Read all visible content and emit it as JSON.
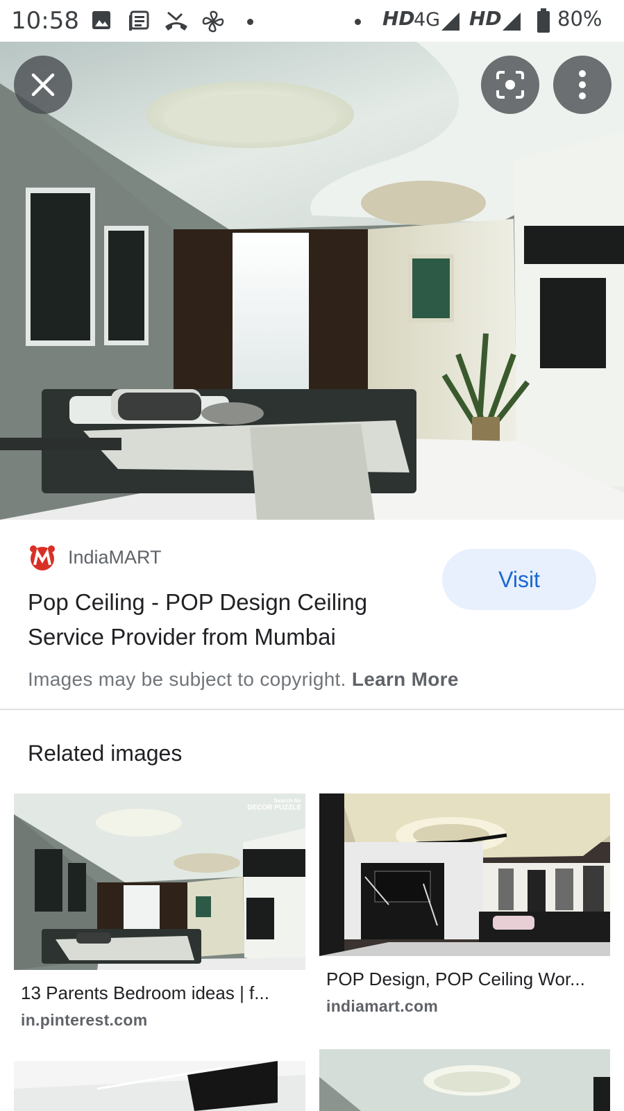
{
  "status_bar": {
    "time": "10:58",
    "network_label_1": "HD",
    "network_type": "4G",
    "network_label_2": "HD",
    "battery": "80%",
    "icons": [
      "image-icon",
      "news-icon",
      "missed-call-icon",
      "fan-icon",
      "notification-dot-icon"
    ]
  },
  "hero": {
    "close_icon": "close-icon",
    "lens_icon": "lens-icon",
    "menu_icon": "more-vert-icon"
  },
  "result": {
    "source_name": "IndiaMART",
    "title": "Pop Ceiling - POP Design Ceiling Service Provider from Mumbai",
    "visit_label": "Visit",
    "copyright_text": "Images may be subject to copyright.",
    "learn_more": "Learn More"
  },
  "related": {
    "heading": "Related images",
    "items": [
      {
        "title": "13 Parents Bedroom ideas | f...",
        "site": "in.pinterest.com",
        "watermark": "DECOR PUZZLE",
        "watermark_small": "Search for"
      },
      {
        "title": "POP Design, POP Ceiling Wor...",
        "site": "indiamart.com"
      }
    ]
  },
  "colors": {
    "accent": "#1967d2",
    "visit_bg": "#e8f0fe",
    "brand_red": "#d93025"
  }
}
